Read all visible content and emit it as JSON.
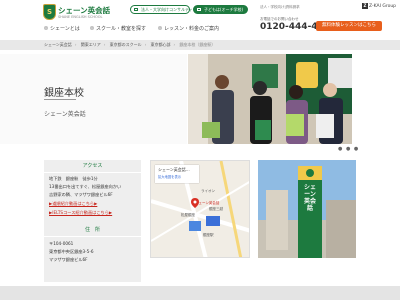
{
  "header": {
    "logo_mark": "S",
    "logo_text": "シェーン英会話",
    "logo_sub": "SHANE ENGLISH SCHOOL",
    "pill_adult": "法人・大学向けコンサルティング",
    "pill_kids": "子どもは(オーチ学校)",
    "top_right_text": "法人・学校向け|資料請求",
    "group_logo": "Z-KAI Group",
    "nav": [
      {
        "label": "シェーンとは"
      },
      {
        "label": "スクール・教室を探す"
      },
      {
        "label": "レッスン・料金のご案内"
      }
    ],
    "phone_label": "お電話でのお問い合わせ",
    "phone": "0120-444-407",
    "cta_label": "無料体験レッスンはこちら"
  },
  "breadcrumb": [
    "シェーン英会話",
    "関東エリア",
    "東京都のスクール",
    "東京都心部",
    "銀座本校（銀座駅）"
  ],
  "school": {
    "title": "銀座本校",
    "subtitle": "シェーン英会話"
  },
  "access": {
    "heading": "アクセス",
    "lines": [
      "地下鉄　銀座駅　徒歩1分",
      "13番出口を出てすぐ、松屋銀座向かい",
      "吉野家の隣、マツザワ銀座ビル6F"
    ],
    "links": [
      "▶道順紹介動画はこちら▶",
      "▶IELTSコース紹介動画はこちら▶"
    ]
  },
  "address": {
    "heading": "住　所",
    "lines": [
      "〒104-0061",
      "東京都中央区銀座3-5-6",
      "マツザワ銀座ビル6F"
    ]
  },
  "map": {
    "card_title": "シェーン英会話…",
    "card_link": "拡大地図を表示",
    "labels": [
      "ライオン",
      "銀座三越",
      "松屋銀座",
      "シェーン英会話",
      "銀座駅"
    ]
  },
  "sign": {
    "text": "シェーン英会話"
  },
  "slider": {
    "dots": "● ● ●"
  },
  "colors": {
    "brand_green": "#1d7a3f",
    "cta_orange": "#e85f1c",
    "link_red": "#c8251c"
  }
}
